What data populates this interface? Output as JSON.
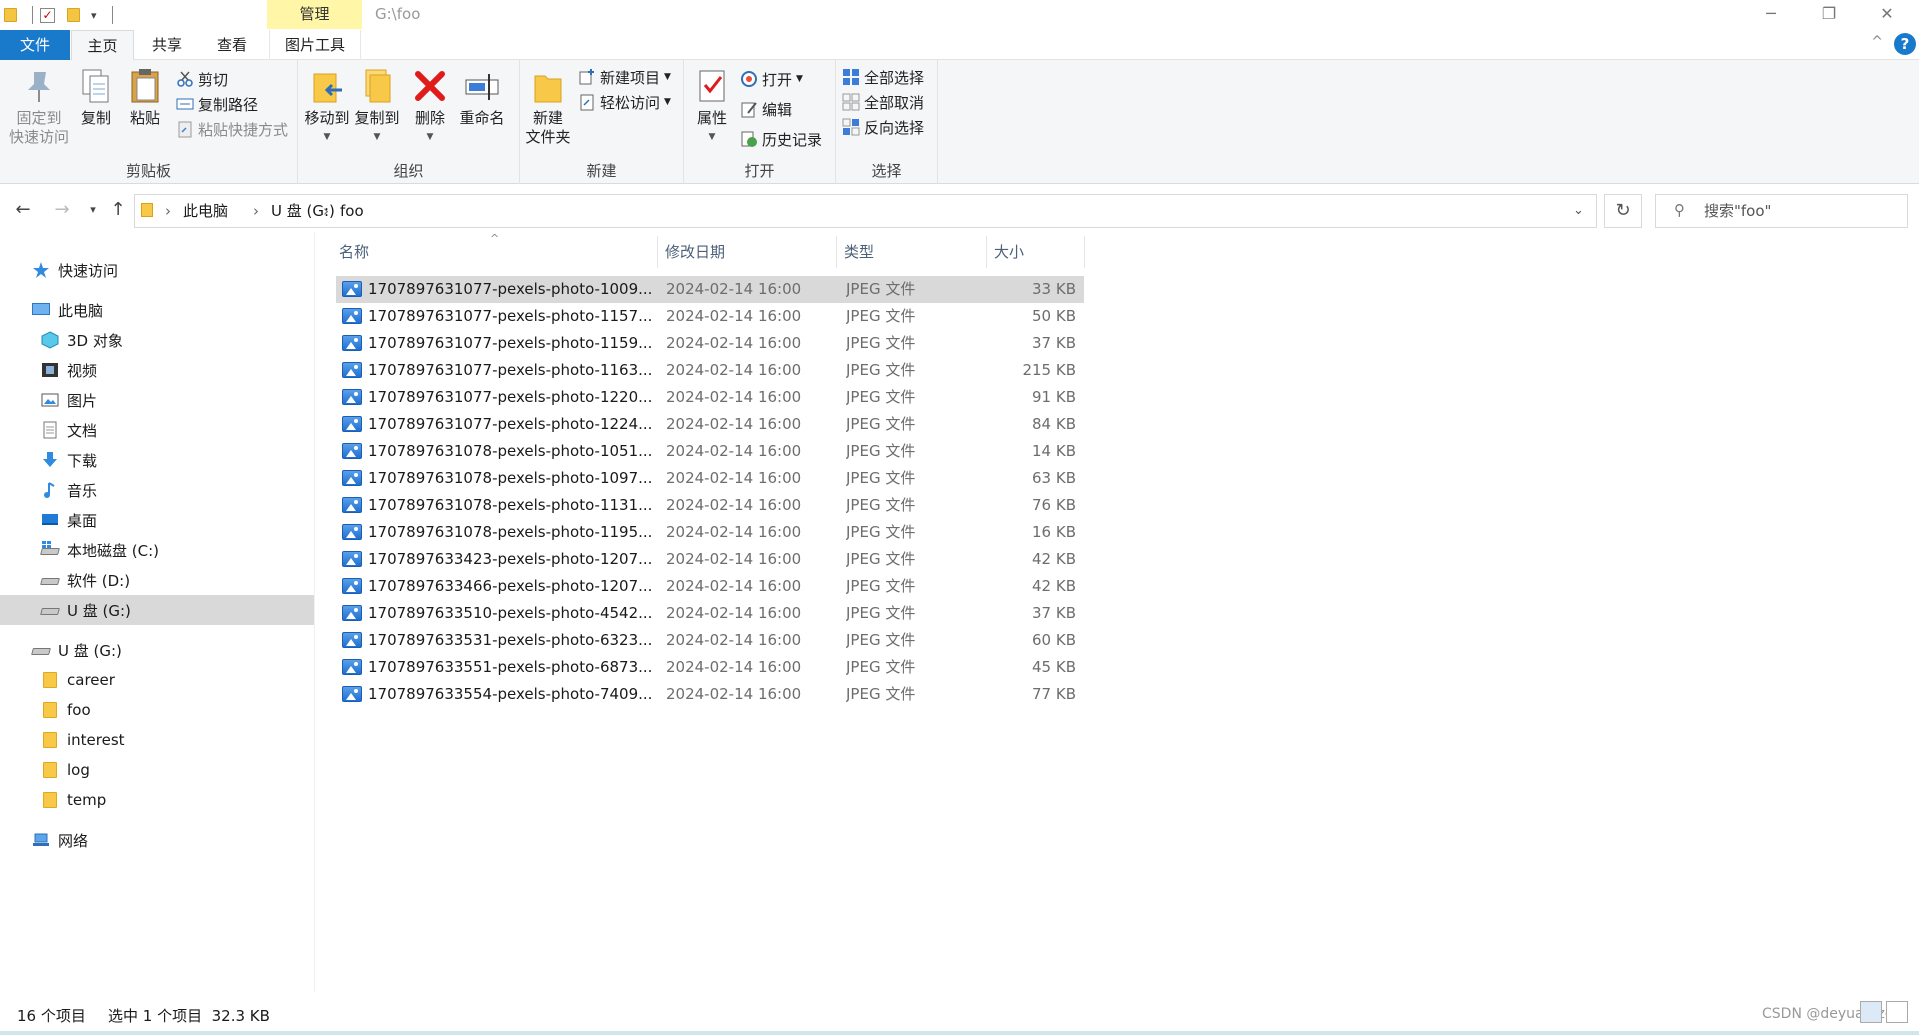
{
  "window": {
    "title": "G:\\foo",
    "context_tab": "管理",
    "controls": {
      "minimize": "─",
      "restore": "❐",
      "close": "✕"
    }
  },
  "ribbon_tabs": {
    "file": "文件",
    "home": "主页",
    "share": "共享",
    "view": "查看",
    "picture_tools": "图片工具",
    "help": "?",
    "collapse": "^"
  },
  "ribbon": {
    "clipboard": {
      "label": "剪贴板",
      "pin_line1": "固定到",
      "pin_line2": "快速访问",
      "copy": "复制",
      "paste": "粘贴",
      "cut": "剪切",
      "copy_path": "复制路径",
      "paste_shortcut": "粘贴快捷方式"
    },
    "organize": {
      "label": "组织",
      "move_to": "移动到",
      "copy_to": "复制到",
      "delete": "删除",
      "rename": "重命名"
    },
    "new": {
      "label": "新建",
      "new_folder_line1": "新建",
      "new_folder_line2": "文件夹",
      "new_item": "新建项目",
      "easy_access": "轻松访问"
    },
    "open": {
      "label": "打开",
      "properties": "属性",
      "open": "打开",
      "edit": "编辑",
      "history": "历史记录"
    },
    "select": {
      "label": "选择",
      "select_all": "全部选择",
      "select_none": "全部取消",
      "invert": "反向选择"
    }
  },
  "address": {
    "crumbs": [
      "此电脑",
      "U 盘 (G:)",
      "foo"
    ],
    "search_placeholder": "搜索\"foo\""
  },
  "nav_pane": {
    "quick_access": "快速访问",
    "this_pc": "此电脑",
    "pc_items": [
      "3D 对象",
      "视频",
      "图片",
      "文档",
      "下载",
      "音乐",
      "桌面",
      "本地磁盘 (C:)",
      "软件 (D:)",
      "U 盘 (G:)"
    ],
    "usb_drive": "U 盘 (G:)",
    "usb_folders": [
      "career",
      "foo",
      "interest",
      "log",
      "temp"
    ],
    "network": "网络"
  },
  "columns": {
    "name": "名称",
    "date": "修改日期",
    "type": "类型",
    "size": "大小"
  },
  "files": [
    {
      "name": "1707897631077-pexels-photo-1009...",
      "date": "2024-02-14 16:00",
      "type": "JPEG 文件",
      "size": "33 KB"
    },
    {
      "name": "1707897631077-pexels-photo-1157...",
      "date": "2024-02-14 16:00",
      "type": "JPEG 文件",
      "size": "50 KB"
    },
    {
      "name": "1707897631077-pexels-photo-1159...",
      "date": "2024-02-14 16:00",
      "type": "JPEG 文件",
      "size": "37 KB"
    },
    {
      "name": "1707897631077-pexels-photo-1163...",
      "date": "2024-02-14 16:00",
      "type": "JPEG 文件",
      "size": "215 KB"
    },
    {
      "name": "1707897631077-pexels-photo-1220...",
      "date": "2024-02-14 16:00",
      "type": "JPEG 文件",
      "size": "91 KB"
    },
    {
      "name": "1707897631077-pexels-photo-1224...",
      "date": "2024-02-14 16:00",
      "type": "JPEG 文件",
      "size": "84 KB"
    },
    {
      "name": "1707897631078-pexels-photo-1051...",
      "date": "2024-02-14 16:00",
      "type": "JPEG 文件",
      "size": "14 KB"
    },
    {
      "name": "1707897631078-pexels-photo-1097...",
      "date": "2024-02-14 16:00",
      "type": "JPEG 文件",
      "size": "63 KB"
    },
    {
      "name": "1707897631078-pexels-photo-1131...",
      "date": "2024-02-14 16:00",
      "type": "JPEG 文件",
      "size": "76 KB"
    },
    {
      "name": "1707897631078-pexels-photo-1195...",
      "date": "2024-02-14 16:00",
      "type": "JPEG 文件",
      "size": "16 KB"
    },
    {
      "name": "1707897633423-pexels-photo-1207...",
      "date": "2024-02-14 16:00",
      "type": "JPEG 文件",
      "size": "42 KB"
    },
    {
      "name": "1707897633466-pexels-photo-1207...",
      "date": "2024-02-14 16:00",
      "type": "JPEG 文件",
      "size": "42 KB"
    },
    {
      "name": "1707897633510-pexels-photo-4542...",
      "date": "2024-02-14 16:00",
      "type": "JPEG 文件",
      "size": "37 KB"
    },
    {
      "name": "1707897633531-pexels-photo-6323...",
      "date": "2024-02-14 16:00",
      "type": "JPEG 文件",
      "size": "60 KB"
    },
    {
      "name": "1707897633551-pexels-photo-6873...",
      "date": "2024-02-14 16:00",
      "type": "JPEG 文件",
      "size": "45 KB"
    },
    {
      "name": "1707897633554-pexels-photo-7409...",
      "date": "2024-02-14 16:00",
      "type": "JPEG 文件",
      "size": "77 KB"
    }
  ],
  "selected_index": 0,
  "status": {
    "count": "16 个项目",
    "selection": "选中 1 个项目  32.3 KB"
  },
  "watermark": "CSDN @deyuan-zc",
  "colors": {
    "accent": "#1979ca",
    "context_tab": "#fff6a8",
    "selection": "#d9d9d9",
    "folder": "#f8c848"
  }
}
